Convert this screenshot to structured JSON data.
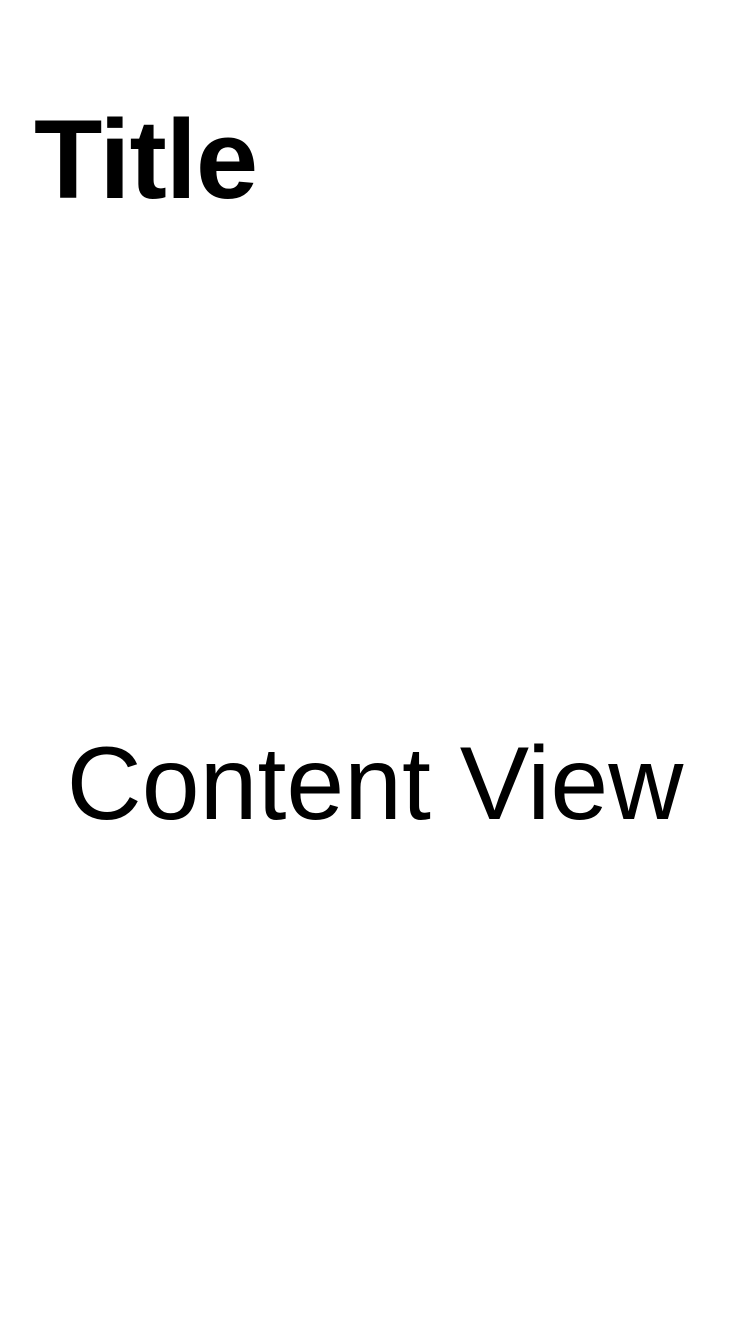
{
  "navigation": {
    "title": "Title"
  },
  "content": {
    "label": "Content View"
  }
}
